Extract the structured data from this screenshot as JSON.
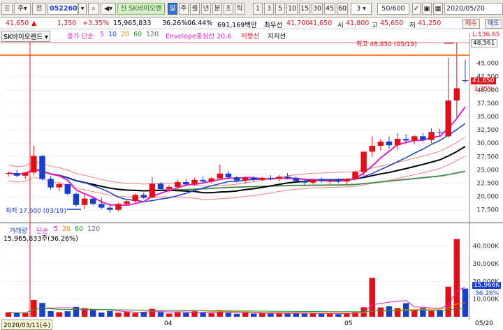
{
  "toolbar": {
    "menu_icon": "hamburger-icon",
    "period_label": "주",
    "type_label": "전",
    "code": "052260",
    "stock_name": "SK바이오랜",
    "tabs": [
      "일",
      "주",
      "월",
      "년",
      "분",
      "초",
      "틱"
    ],
    "intervals": [
      "1",
      "3",
      "5",
      "10",
      "15",
      "30",
      "45",
      "60"
    ],
    "interval_value": "3",
    "count": "50/600",
    "date": "2020/05/20"
  },
  "pricebar": {
    "price": "41,650",
    "arrow": "▲",
    "change": "1,350",
    "change_pct": "+3.35%",
    "volume": "15,965,833",
    "vol_ratio": "36.26%",
    "turnover": "06.44%",
    "amount": "691,169백만",
    "last_label": "최우선",
    "last": "41,700",
    "last2": "41,650",
    "open_label": "시",
    "open": "41,800",
    "high_label": "고",
    "high": "45,650",
    "low_label": "저",
    "low": "41,250",
    "buy": "매수",
    "sell": "매도"
  },
  "legend": {
    "name": "SK바이오랜드",
    "ma_label": "종가 단순",
    "ma": [
      "5",
      "10",
      "20",
      "60",
      "120"
    ],
    "env": "Envelope중심선 20,6",
    "resist": "저항선",
    "support": "지지선"
  },
  "annotations": {
    "high": "최고 48,850 (05/19)",
    "low": "최저 17,600 (03/19)",
    "right_top": "L:136.65",
    "right_price": "48,561",
    "current": "41,650",
    "current_pct": "3.35%"
  },
  "volume_legend": {
    "name": "거래량",
    "ma_label": "단순",
    "ma": [
      "5",
      "20",
      "60",
      "120"
    ],
    "value": "15,965,833주(36.26%)",
    "current": "15,966K",
    "current_pct": "36.26%"
  },
  "xaxis": {
    "start": "2020/03/11(수)",
    "labels": [
      "04",
      "05",
      "05/20"
    ]
  },
  "colors": {
    "up": "#e0101b",
    "down": "#1a3fc7",
    "resist": "#ff7f27"
  },
  "chart_data": {
    "type": "candlestick",
    "yticks": [
      17500,
      20000,
      22500,
      25000,
      27500,
      30000,
      32500,
      35000,
      37500,
      40000,
      42500,
      45000
    ],
    "ylim": [
      15500,
      49000
    ],
    "vol_ticks": [
      "10,000K",
      "20,000K",
      "30,000K",
      "40,000K"
    ],
    "vol_max": 47000,
    "resistance": 46500,
    "candles": [
      [
        24300,
        24700,
        23700,
        24400
      ],
      [
        24400,
        25000,
        23600,
        23900
      ],
      [
        23900,
        24700,
        23300,
        24500
      ],
      [
        24500,
        29500,
        24000,
        27600
      ],
      [
        27600,
        27800,
        23000,
        23300
      ],
      [
        23300,
        23800,
        21200,
        21700
      ],
      [
        21700,
        22700,
        21000,
        22300
      ],
      [
        22300,
        22400,
        20200,
        20500
      ],
      [
        20500,
        20700,
        18000,
        18400
      ],
      [
        18400,
        20300,
        17600,
        19600
      ],
      [
        19600,
        19800,
        18300,
        18600
      ],
      [
        18600,
        19800,
        17600,
        17900
      ],
      [
        17900,
        18700,
        16900,
        17500
      ],
      [
        17500,
        18800,
        17200,
        18600
      ],
      [
        18600,
        19400,
        18300,
        19100
      ],
      [
        19100,
        20600,
        18800,
        20300
      ],
      [
        20300,
        20700,
        19500,
        19800
      ],
      [
        19800,
        23700,
        19600,
        22400
      ],
      [
        22400,
        22700,
        21000,
        21400
      ],
      [
        21400,
        22100,
        20800,
        21800
      ],
      [
        21800,
        23200,
        21400,
        22700
      ],
      [
        22700,
        23300,
        22100,
        22300
      ],
      [
        22300,
        23500,
        22000,
        23100
      ],
      [
        23100,
        23800,
        22600,
        22800
      ],
      [
        22800,
        23600,
        22400,
        23400
      ],
      [
        23400,
        26000,
        23100,
        24300
      ],
      [
        24300,
        24800,
        23200,
        23600
      ],
      [
        23600,
        23900,
        22600,
        23000
      ],
      [
        23000,
        23700,
        22400,
        23500
      ],
      [
        23500,
        23800,
        22700,
        23100
      ],
      [
        23100,
        23700,
        22900,
        23500
      ],
      [
        23500,
        24000,
        23000,
        23300
      ],
      [
        23300,
        24000,
        22800,
        23700
      ],
      [
        23700,
        24400,
        23200,
        23400
      ],
      [
        23400,
        23700,
        22700,
        22900
      ],
      [
        22900,
        23300,
        22100,
        22600
      ],
      [
        22600,
        23400,
        22300,
        23100
      ],
      [
        23100,
        23500,
        22600,
        22900
      ],
      [
        22900,
        23300,
        22400,
        23000
      ],
      [
        23000,
        23400,
        22500,
        22800
      ],
      [
        22800,
        23400,
        22200,
        23300
      ],
      [
        23300,
        24800,
        23000,
        24600
      ],
      [
        24600,
        26500,
        23900,
        28400
      ],
      [
        28400,
        31300,
        27500,
        29500
      ],
      [
        29500,
        30800,
        28600,
        30300
      ],
      [
        30300,
        31200,
        29000,
        29600
      ],
      [
        29600,
        31900,
        28700,
        30800
      ],
      [
        30800,
        31700,
        29900,
        30500
      ],
      [
        30500,
        31500,
        29800,
        31300
      ],
      [
        31300,
        31900,
        30200,
        30600
      ],
      [
        30600,
        32800,
        30000,
        32100
      ],
      [
        32100,
        32700,
        31300,
        32000
      ],
      [
        31300,
        46000,
        31000,
        38000
      ],
      [
        38000,
        48850,
        34800,
        40300
      ],
      [
        41800,
        45650,
        41250,
        41650
      ]
    ],
    "volume": [
      2500,
      2000,
      2100,
      9500,
      7800,
      3200,
      2600,
      3100,
      5600,
      4900,
      3700,
      2400,
      3300,
      2300,
      2700,
      2100,
      2700,
      4500,
      2600,
      1800,
      2500,
      2300,
      3100,
      2500,
      2000,
      3700,
      2300,
      1700,
      2300,
      1800,
      2000,
      1900,
      2000,
      1900,
      2100,
      1700,
      1800,
      1700,
      1900,
      1500,
      2200,
      2700,
      5400,
      22000,
      5300,
      5900,
      4900,
      7700,
      3900,
      5000,
      3300,
      3900,
      17000,
      44000,
      15966
    ]
  }
}
